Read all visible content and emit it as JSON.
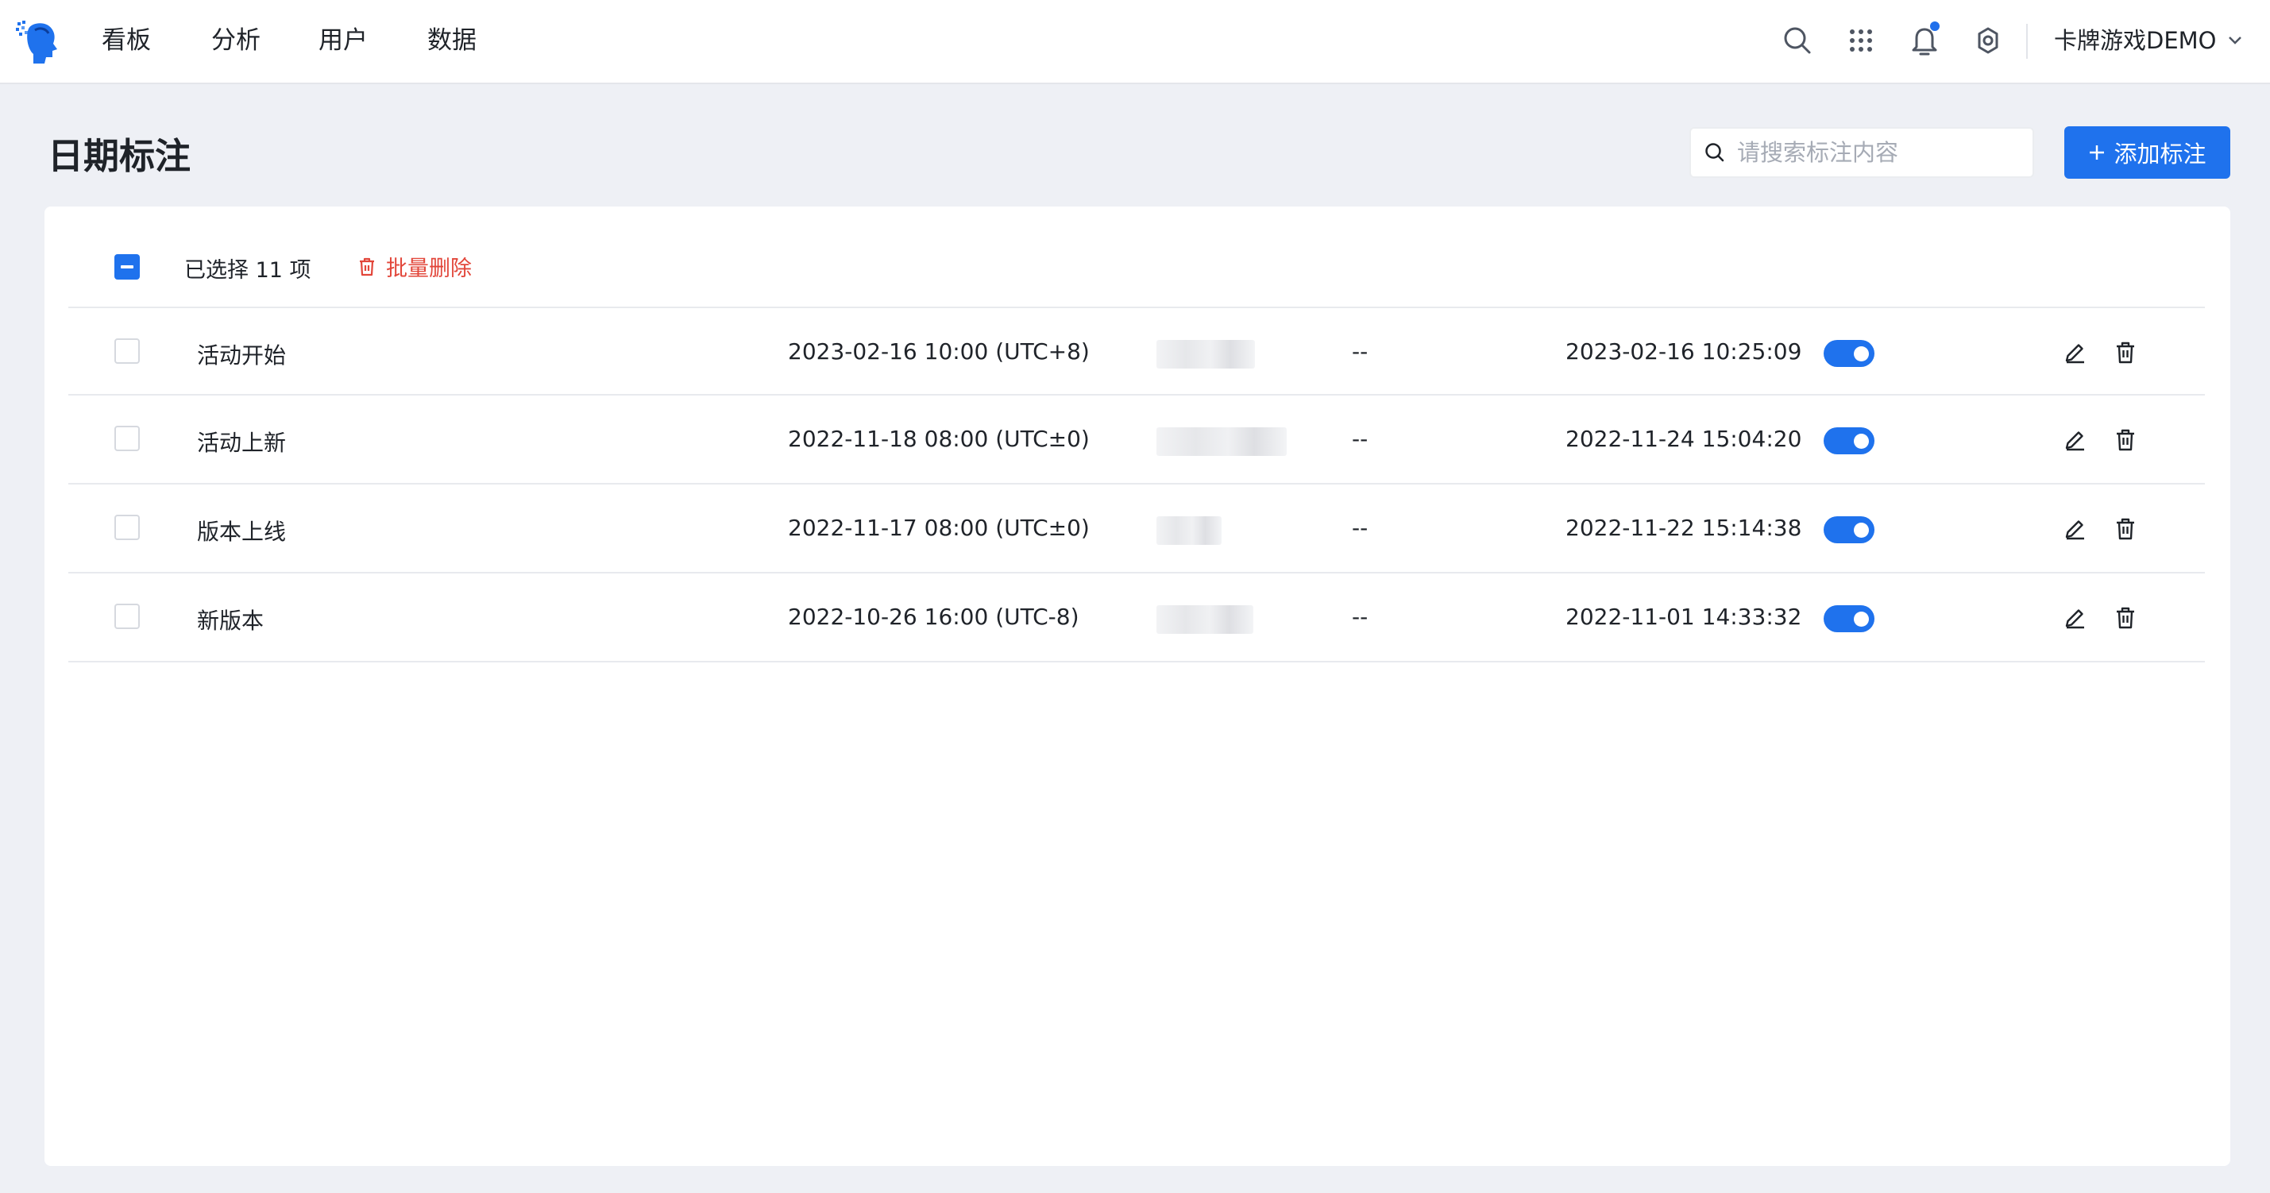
{
  "nav": {
    "items": [
      "看板",
      "分析",
      "用户",
      "数据"
    ],
    "project_name": "卡牌游戏DEMO",
    "icons": [
      "search-icon",
      "apps-grid-icon",
      "bell-icon",
      "gear-icon"
    ]
  },
  "page": {
    "title": "日期标注",
    "search_placeholder": "请搜索标注内容",
    "add_button_label": "添加标注"
  },
  "selection": {
    "text": "已选择 11 项",
    "bulk_delete_label": "批量删除"
  },
  "rows": [
    {
      "name": "活动开始",
      "date": "2023-02-16 10:00 (UTC+8)",
      "description": "--",
      "updated": "2023-02-16 10:25:09",
      "enabled": true
    },
    {
      "name": "活动上新",
      "date": "2022-11-18 08:00 (UTC±0)",
      "description": "--",
      "updated": "2022-11-24 15:04:20",
      "enabled": true
    },
    {
      "name": "版本上线",
      "date": "2022-11-17 08:00 (UTC±0)",
      "description": "--",
      "updated": "2022-11-22 15:14:38",
      "enabled": true
    },
    {
      "name": "新版本",
      "date": "2022-10-26 16:00 (UTC-8)",
      "description": "--",
      "updated": "2022-11-01 14:33:32",
      "enabled": true
    }
  ],
  "colors": {
    "accent": "#1f72ed",
    "danger": "#e2463a",
    "background": "#eef0f5"
  }
}
